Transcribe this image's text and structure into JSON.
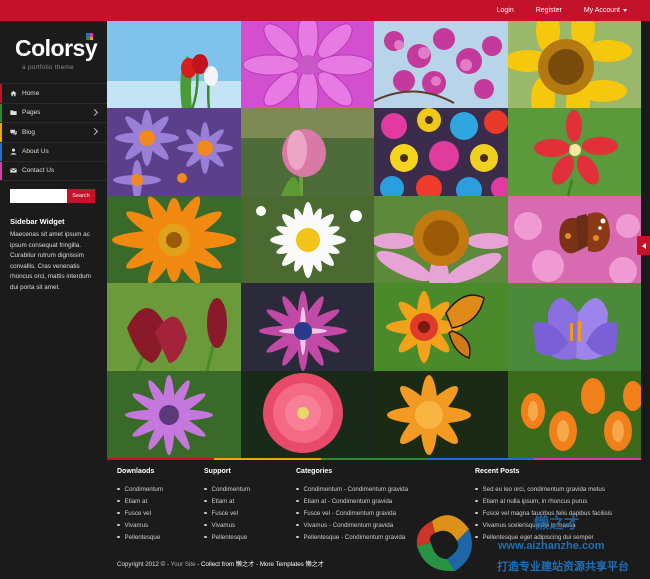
{
  "topnav": {
    "login": "Login",
    "register": "Register",
    "account": "My Account"
  },
  "sidebar": {
    "logo": "Colorsy",
    "tagline": "a portfolio theme",
    "menu": [
      {
        "label": "Home",
        "icon": "home-icon",
        "color": "#c4122a"
      },
      {
        "label": "Pages",
        "icon": "folder-icon",
        "color": "#2e8b2e"
      },
      {
        "label": "Blog",
        "icon": "comments-icon",
        "color": "#e8a80c"
      },
      {
        "label": "About Us",
        "icon": "user-icon",
        "color": "#1f6fcf"
      },
      {
        "label": "Contact Us",
        "icon": "envelope-icon",
        "color": "#d63da6"
      }
    ],
    "search": {
      "placeholder": "",
      "button": "Search"
    },
    "widget": {
      "title": "Sidebar Widget",
      "text": "Maecenas sit amet ipsum ac ipsum consequat fringilla. Curabitur rutrum dignissim convallis. Cras venenatis rhoncus orci, mattis interdum dui porta sit amet."
    }
  },
  "footer": {
    "downloads": {
      "title": "Downlaods",
      "items": [
        "Condimentum",
        "Etiam at",
        "Fusce vel",
        "Vivamus",
        "Pellentesque"
      ]
    },
    "support": {
      "title": "Support",
      "items": [
        "Condimentum",
        "Etiam at",
        "Fusce vel",
        "Vivamus",
        "Pellentesque"
      ]
    },
    "categories": {
      "title": "Categories",
      "items": [
        "Condimentum - Condimentum gravida",
        "Etiam at - Condimentum gravida",
        "Fusce vel - Condimentum gravida",
        "Vivamus - Condimentum gravida",
        "Pellentesque - Condimentum gravida"
      ]
    },
    "recent": {
      "title": "Recent Posts",
      "items": [
        "Sed eu leo orci, condimentum gravida metus",
        "Etiam at nulla ipsum, in rhoncus purus",
        "Fusce vel magna faucibus felis dapibus facilisis",
        "Vivamus scelerisque dui in massa",
        "Pellentesque eget adipiscing dui semper"
      ]
    },
    "copyright": {
      "prefix": "Copyright 2012 © -",
      "site": "Your Site",
      "collect": "- Collect from 懒之才",
      "more": "- More Templates 懒之才"
    }
  },
  "watermark": {
    "site": "www.aizhanzhe.com",
    "slogan": "打造专业建站资源共享平台",
    "brand": "懒之才"
  },
  "colors": {
    "accent": "#c4122a",
    "sidebar": "#1b1b1b"
  }
}
